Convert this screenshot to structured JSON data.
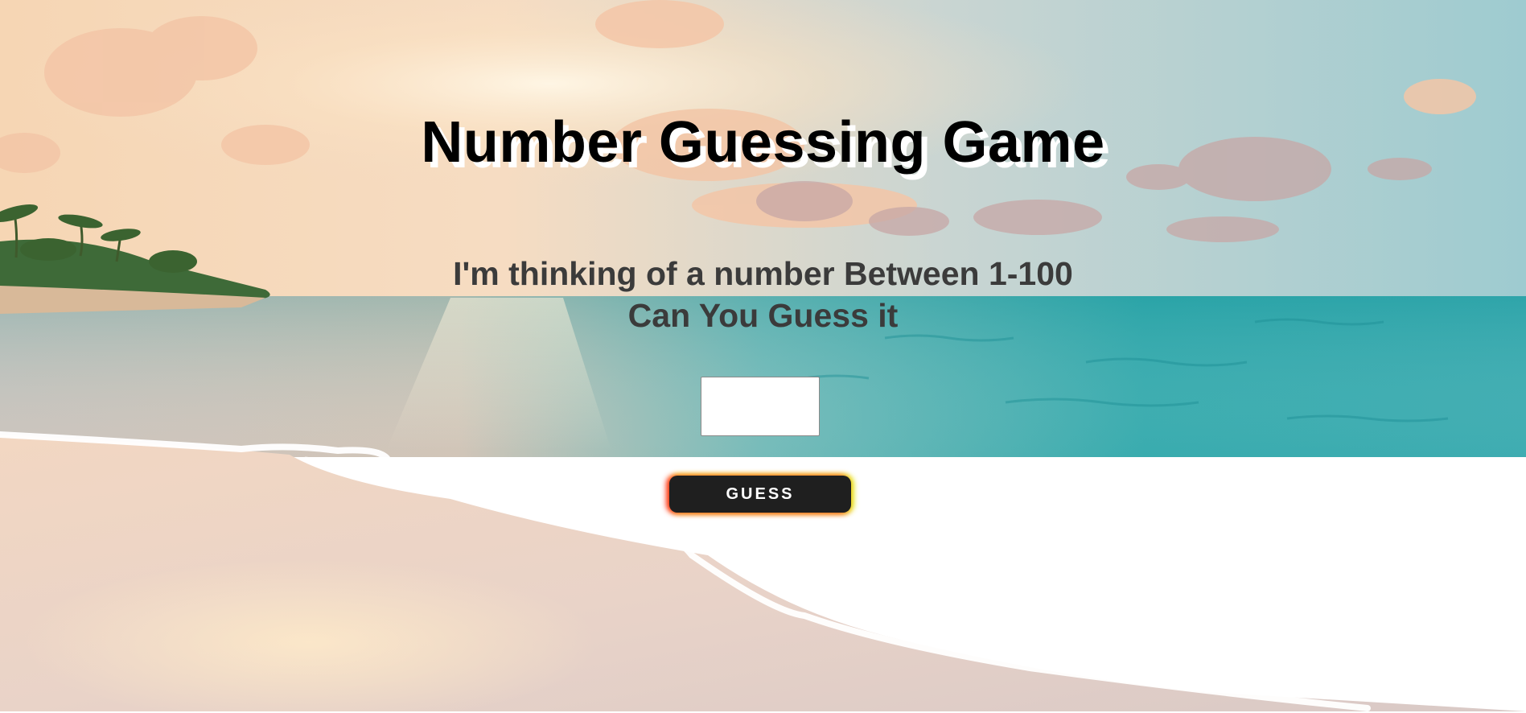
{
  "game": {
    "title": "Number Guessing Game",
    "prompt_line1": "I'm thinking of a number Between 1-100",
    "prompt_line2": "Can You Guess it",
    "guess_input_value": "",
    "guess_button_label": "GUESS"
  },
  "colors": {
    "title_text": "#000000",
    "title_shadow": "#ffffff",
    "prompt_text": "#3b3b3b",
    "button_background": "#1f1f1f",
    "button_text": "#ffffff",
    "button_glow_left": "#ff2814",
    "button_glow_right": "#e6eb1e",
    "sky_top": "#9fc9cb",
    "sky_sunset": "#f7dcc0",
    "sea": "#2aa6a8",
    "sand": "#ead6c9"
  },
  "background": {
    "scene": "tropical beach at sunset"
  }
}
